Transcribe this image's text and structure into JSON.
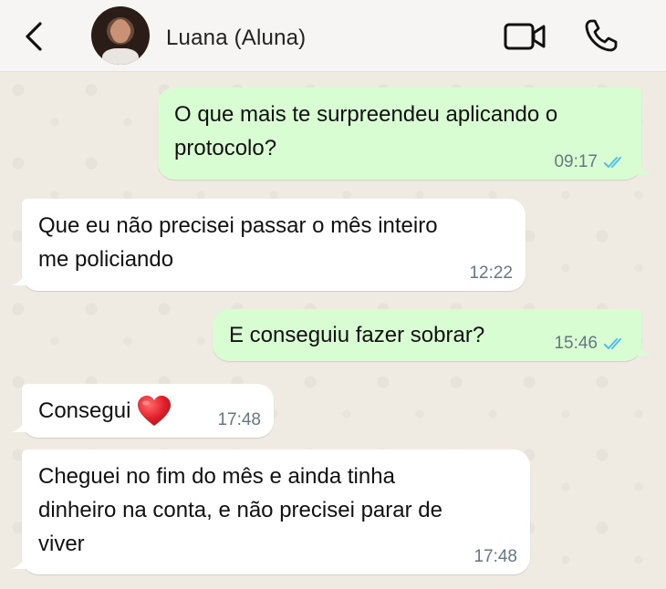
{
  "header": {
    "contact_name": "Luana (Aluna)"
  },
  "messages": [
    {
      "direction": "out",
      "text_line1": "O que mais te surpreendeu aplicando o",
      "text_line2": "protocolo?",
      "time": "09:17",
      "status": "read"
    },
    {
      "direction": "in",
      "text_line1": "Que eu não precisei passar o mês inteiro",
      "text_line2": "me policiando",
      "time": "12:22"
    },
    {
      "direction": "out",
      "text_line1": "E conseguiu fazer sobrar?",
      "time": "15:46",
      "status": "read"
    },
    {
      "direction": "in",
      "text_line1": "Consegui",
      "emoji": "red-heart",
      "time": "17:48"
    },
    {
      "direction": "in",
      "text_line1": "Cheguei no fim do mês e ainda tinha",
      "text_line2": "dinheiro na conta, e não precisei parar de",
      "text_line3": "viver",
      "time": "17:48"
    }
  ],
  "colors": {
    "outgoing_bubble": "#d9fdd3",
    "incoming_bubble": "#ffffff",
    "read_ticks": "#53bdeb",
    "wallpaper": "#efeae2"
  }
}
